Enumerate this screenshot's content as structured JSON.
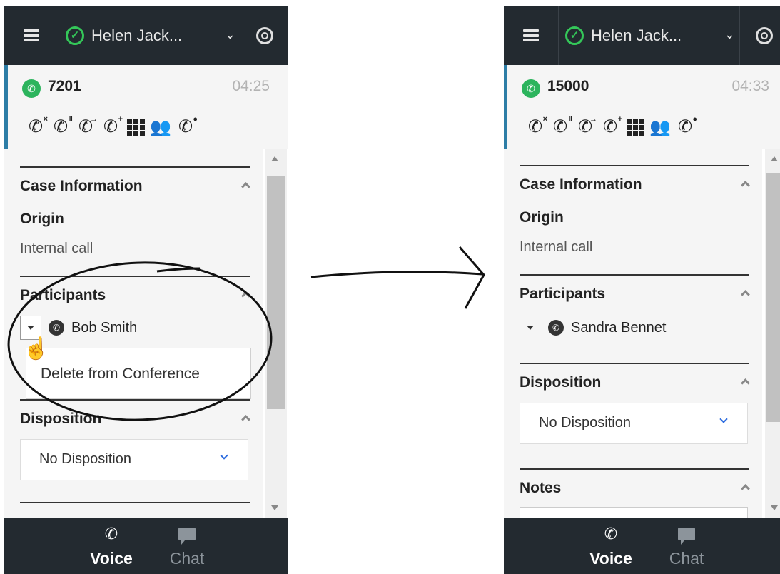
{
  "panels": {
    "before": {
      "agent_name": "Helen Jack...",
      "call_number": "7201",
      "call_timer": "04:25",
      "case_information": {
        "title": "Case Information",
        "origin_label": "Origin",
        "origin_value": "Internal call"
      },
      "participants": {
        "title": "Participants",
        "participant_name": "Bob Smith",
        "menu_item": "Delete from Conference"
      },
      "disposition": {
        "title": "Disposition",
        "value": "No Disposition"
      },
      "tabs": {
        "voice": "Voice",
        "chat": "Chat"
      }
    },
    "after": {
      "agent_name": "Helen Jack...",
      "call_number": "15000",
      "call_timer": "04:33",
      "case_information": {
        "title": "Case Information",
        "origin_label": "Origin",
        "origin_value": "Internal call"
      },
      "participants": {
        "title": "Participants",
        "participant_name": "Sandra Bennet"
      },
      "disposition": {
        "title": "Disposition",
        "value": "No Disposition"
      },
      "notes": {
        "title": "Notes"
      },
      "tabs": {
        "voice": "Voice",
        "chat": "Chat"
      }
    }
  },
  "icons": {
    "menu": "hamburger-menu-icon",
    "status": "ready-status-icon",
    "support": "support-icon",
    "call_actions": [
      "end-call-icon",
      "hold-call-icon",
      "transfer-call-icon",
      "conference-call-icon",
      "keypad-icon",
      "consult-icon",
      "record-call-icon"
    ]
  },
  "colors": {
    "topbar": "#232a30",
    "status_green": "#34c759",
    "call_green": "#2cb45d",
    "accent_blue": "#2d7da6",
    "dropdown_blue": "#2d6cdf"
  }
}
